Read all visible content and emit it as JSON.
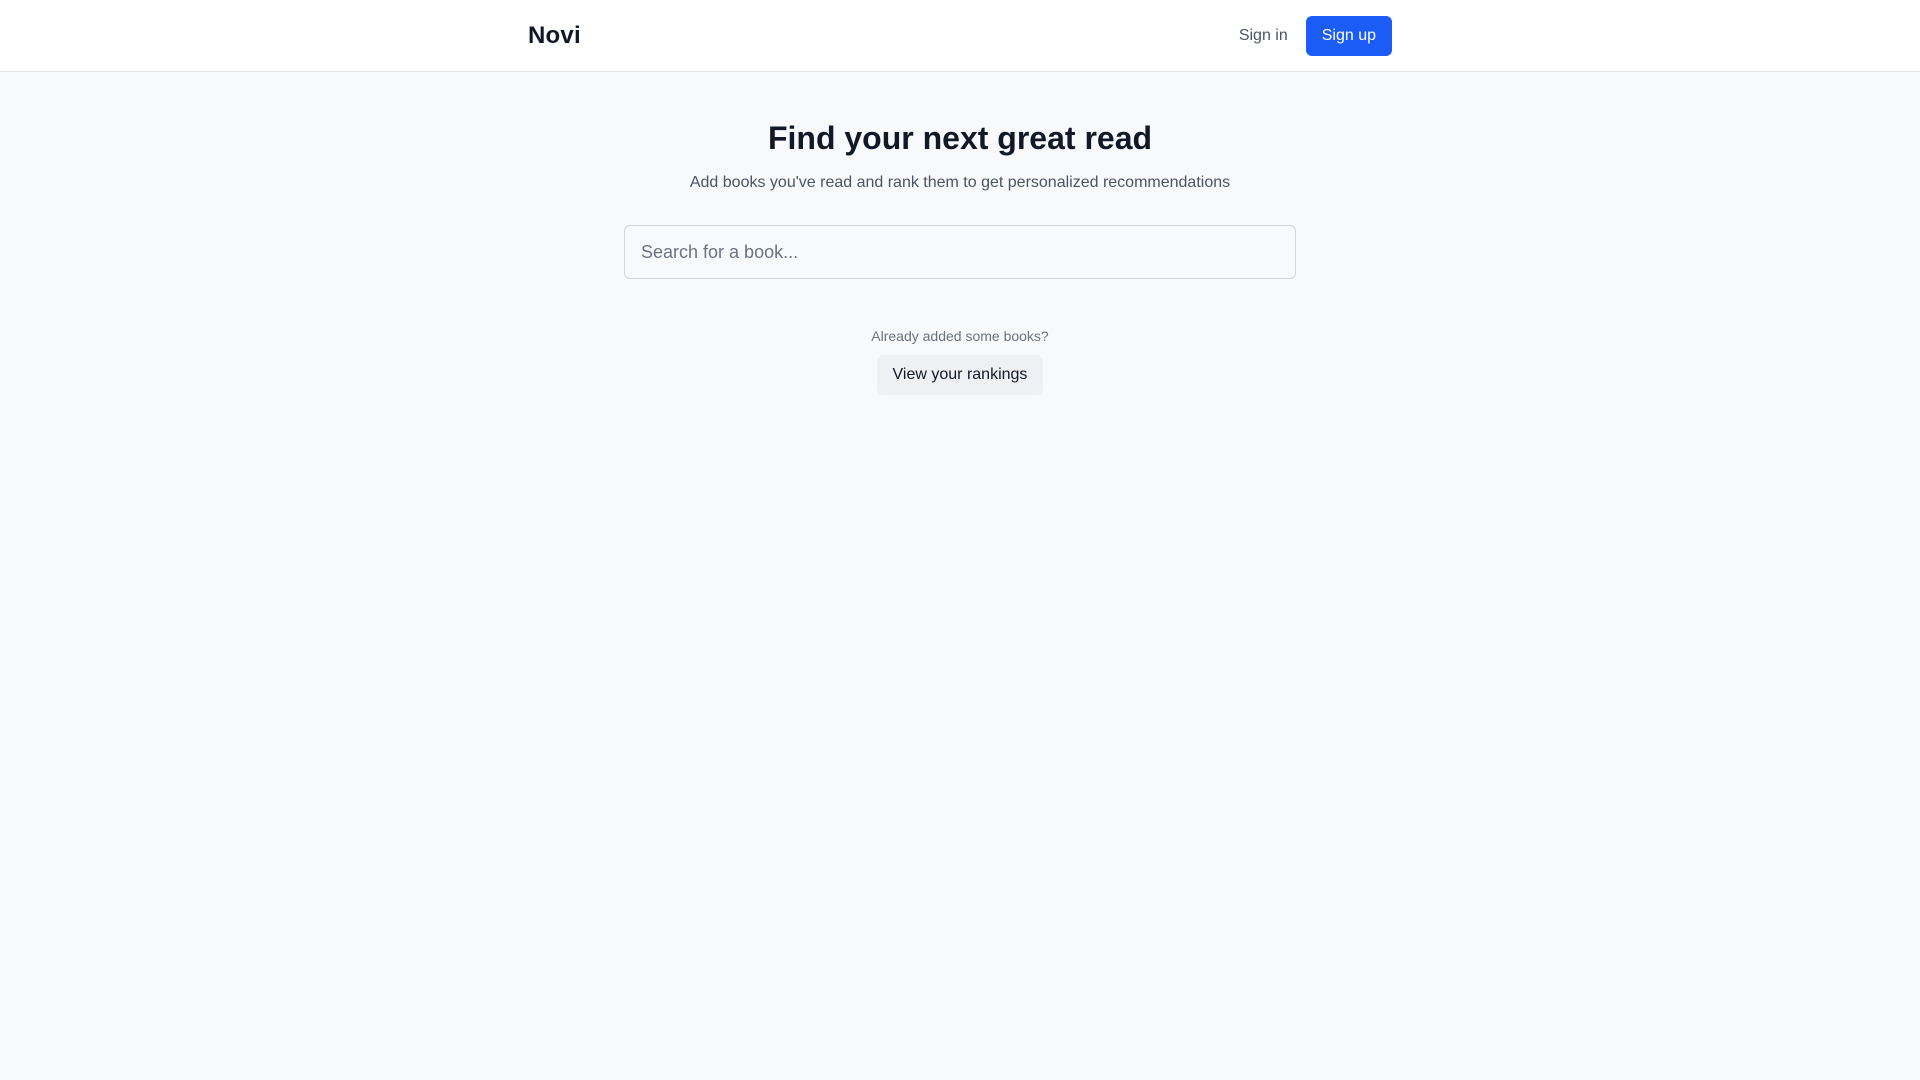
{
  "header": {
    "logo": "Novi",
    "signin_label": "Sign in",
    "signup_label": "Sign up"
  },
  "hero": {
    "title": "Find your next great read",
    "subtitle": "Add books you've read and rank them to get personalized recommendations"
  },
  "search": {
    "value": "",
    "placeholder": "Search for a book..."
  },
  "rankings": {
    "prompt": "Already added some books?",
    "button_label": "View your rankings"
  },
  "colors": {
    "accent": "#1a5cf5",
    "background": "#f8f9fb"
  }
}
